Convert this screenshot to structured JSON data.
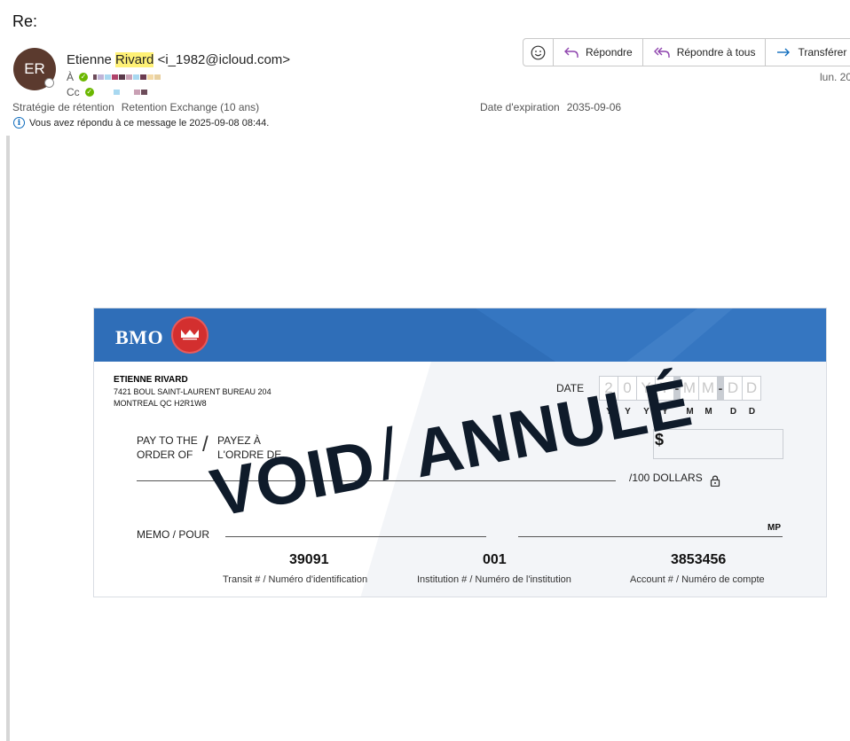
{
  "email": {
    "subject": "Re:",
    "avatar_initials": "ER",
    "sender_first": "Etienne",
    "sender_last": "Rivard",
    "sender_email": "<i_1982@icloud.com>",
    "to_label": "À",
    "cc_label": "Cc",
    "date_partial": "lun. 20",
    "retention_label": "Stratégie de rétention",
    "retention_value": "Retention Exchange (10 ans)",
    "expiry_label": "Date d'expiration",
    "expiry_value": "2035-09-06",
    "info_text": "Vous avez répondu à ce message le 2025-09-08 08:44."
  },
  "actions": {
    "emoji_icon": "smiley-icon",
    "reply": "Répondre",
    "reply_all": "Répondre à tous",
    "forward": "Transférer"
  },
  "cheque": {
    "bank": "BMO",
    "payer_name": "ETIENNE RIVARD",
    "payer_address_line1": "7421 BOUL SAINT-LAURENT BUREAU 204",
    "payer_address_line2": "MONTREAL QC H2R1W8",
    "date_label": "DATE",
    "date_boxes": [
      "2",
      "0",
      "Y",
      "Y",
      "M",
      "M",
      "D",
      "D"
    ],
    "date_hints": [
      "Y",
      "Y",
      "Y",
      "Y",
      "M",
      "M",
      "D",
      "D"
    ],
    "pay_en": "PAY TO THE ORDER OF",
    "pay_fr": "PAYEZ À L'ORDRE DE",
    "dollar_sign": "$",
    "dollars_label": "/100 DOLLARS",
    "memo_label": "MEMO / POUR",
    "mp_label": "MP",
    "transit_number": "39091",
    "institution_number": "001",
    "account_number": "3853456",
    "transit_caption": "Transit #  /  Numéro d'identification",
    "institution_caption": "Institution #  /  Numéro de l'institution",
    "account_caption": "Account #  /  Numéro de compte",
    "stamp_void": "VOID",
    "stamp_annule": "ANNULÉ"
  },
  "colors": {
    "bmo_blue": "#2f6eb8",
    "bmo_red": "#d32f2f",
    "highlight": "#fff176",
    "avatar_bg": "#5b3a2e",
    "reply_icon": "#8e44ad",
    "forward_icon": "#0f6cbd"
  }
}
